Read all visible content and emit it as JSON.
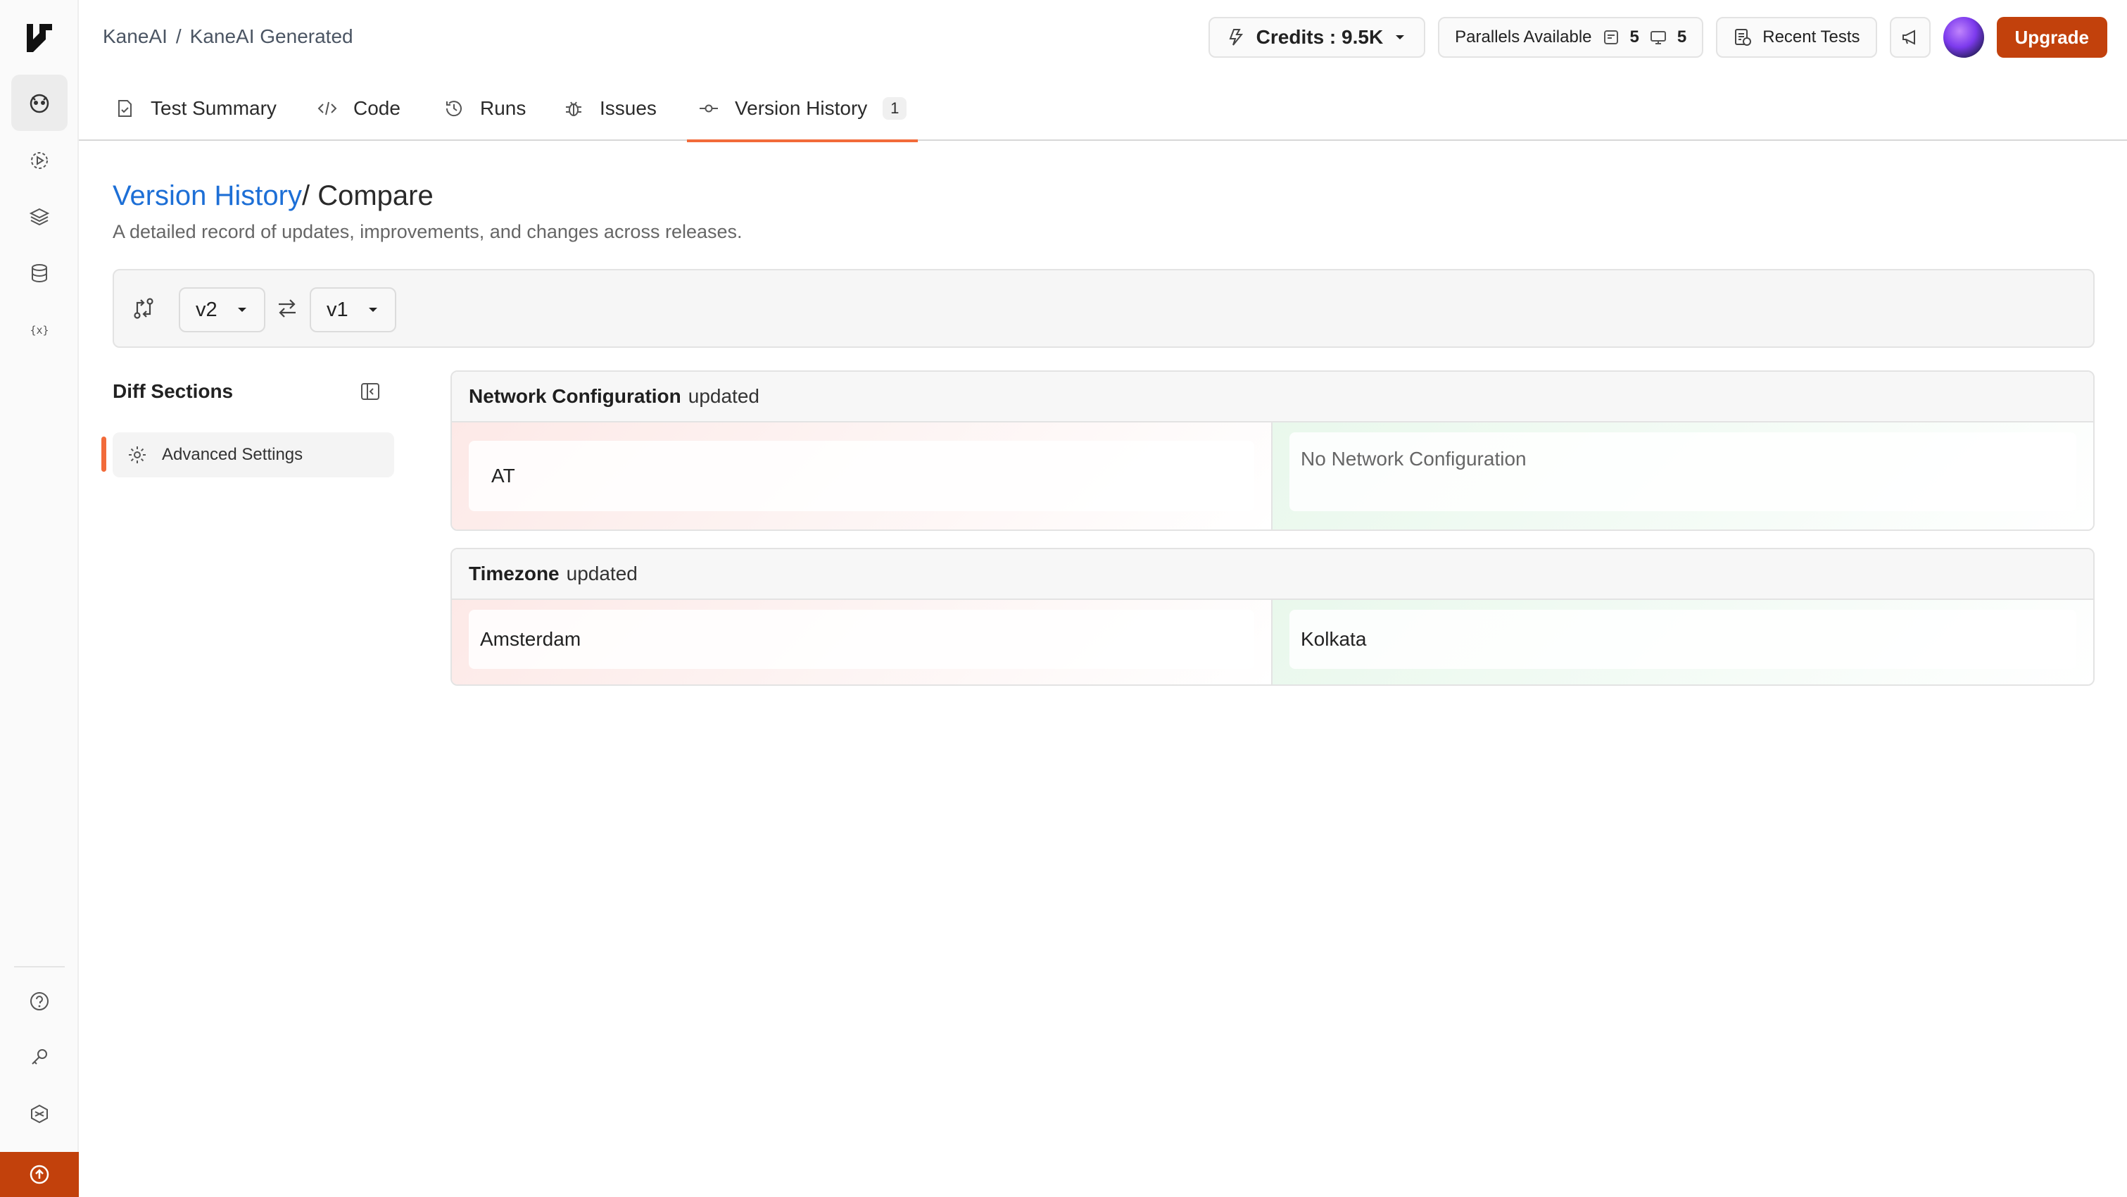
{
  "breadcrumb": {
    "root": "KaneAI",
    "separator": "/",
    "current": "KaneAI Generated"
  },
  "header": {
    "credits_label": "Credits : 9.5K",
    "parallels_label": "Parallels Available",
    "parallels_web": "5",
    "parallels_mobile": "5",
    "recent_tests_label": "Recent Tests",
    "upgrade_label": "Upgrade"
  },
  "tabs": [
    {
      "label": "Test Summary"
    },
    {
      "label": "Code"
    },
    {
      "label": "Runs"
    },
    {
      "label": "Issues"
    },
    {
      "label": "Version History",
      "badge": "1",
      "active": true
    }
  ],
  "page": {
    "title_link": "Version History",
    "title_rest": "/ Compare",
    "subtitle": "A detailed record of updates, improvements, and changes across releases."
  },
  "compare": {
    "left_version": "v2",
    "right_version": "v1"
  },
  "diff_sections": {
    "heading": "Diff Sections",
    "items": [
      {
        "label": "Advanced Settings"
      }
    ]
  },
  "diffs": [
    {
      "field": "Network Configuration",
      "status": "updated",
      "old_value": "AT",
      "new_value": "No Network Configuration"
    },
    {
      "field": "Timezone",
      "status": "updated",
      "old_value": "Amsterdam",
      "new_value": "Kolkata"
    }
  ],
  "colors": {
    "accent": "#c2410c",
    "tab_underline": "#f26b3a",
    "link": "#1d6fd6"
  }
}
